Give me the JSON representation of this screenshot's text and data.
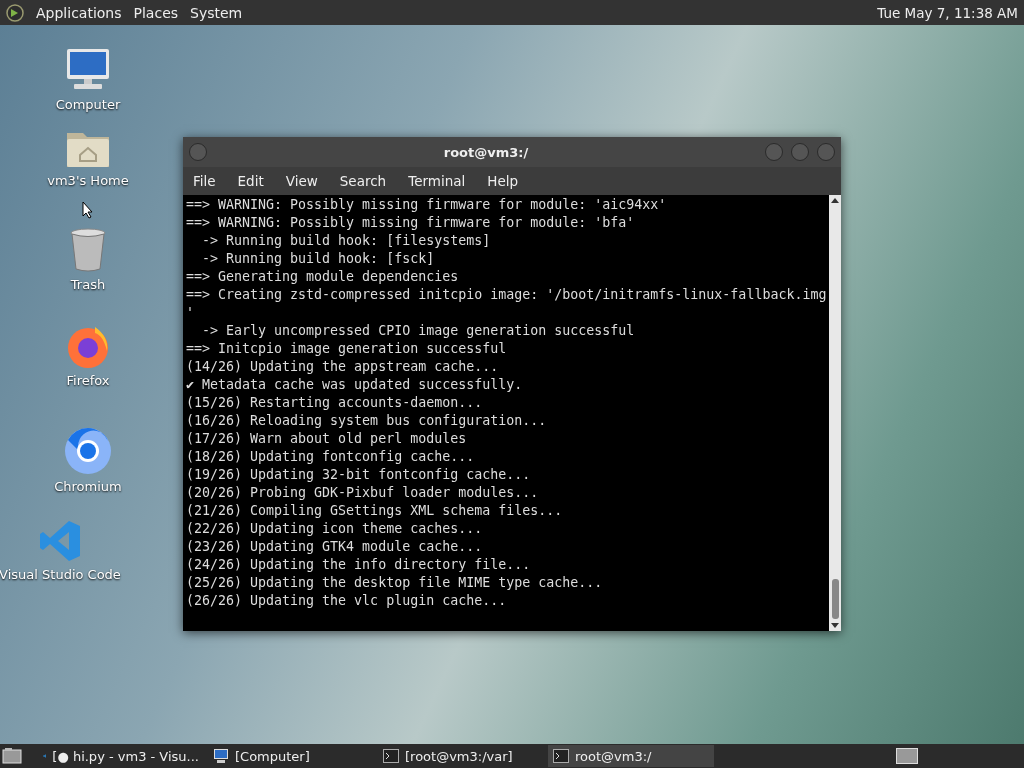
{
  "top_panel": {
    "menus": [
      "Applications",
      "Places",
      "System"
    ],
    "clock": "Tue May  7, 11:38 AM"
  },
  "desktop_icons": [
    {
      "kind": "computer",
      "label": "Computer"
    },
    {
      "kind": "home",
      "label": "vm3's Home"
    },
    {
      "kind": "trash",
      "label": "Trash"
    },
    {
      "kind": "firefox",
      "label": "Firefox"
    },
    {
      "kind": "chromium",
      "label": "Chromium"
    },
    {
      "kind": "vscode",
      "label": "Visual Studio Code"
    }
  ],
  "window": {
    "title": "root@vm3:/",
    "menu": [
      "File",
      "Edit",
      "View",
      "Search",
      "Terminal",
      "Help"
    ],
    "lines": [
      "==> WARNING: Possibly missing firmware for module: 'aic94xx'",
      "==> WARNING: Possibly missing firmware for module: 'bfa'",
      "  -> Running build hook: [filesystems]",
      "  -> Running build hook: [fsck]",
      "==> Generating module dependencies",
      "==> Creating zstd-compressed initcpio image: '/boot/initramfs-linux-fallback.img",
      "'",
      "  -> Early uncompressed CPIO image generation successful",
      "==> Initcpio image generation successful",
      "(14/26) Updating the appstream cache...",
      "✔ Metadata cache was updated successfully.",
      "(15/26) Restarting accounts-daemon...",
      "(16/26) Reloading system bus configuration...",
      "(17/26) Warn about old perl modules",
      "(18/26) Updating fontconfig cache...",
      "(19/26) Updating 32-bit fontconfig cache...",
      "(20/26) Probing GDK-Pixbuf loader modules...",
      "(21/26) Compiling GSettings XML schema files...",
      "(22/26) Updating icon theme caches...",
      "(23/26) Updating GTK4 module cache...",
      "(24/26) Updating the info directory file...",
      "(25/26) Updating the desktop file MIME type cache...",
      "(26/26) Updating the vlc plugin cache..."
    ]
  },
  "taskbar": [
    {
      "kind": "vscode",
      "label": "[● hi.py - vm3 - Visu...",
      "selected": false
    },
    {
      "kind": "computer",
      "label": "[Computer]",
      "selected": false
    },
    {
      "kind": "terminal",
      "label": "[root@vm3:/var]",
      "selected": false
    },
    {
      "kind": "terminal",
      "label": "root@vm3:/",
      "selected": true
    }
  ]
}
